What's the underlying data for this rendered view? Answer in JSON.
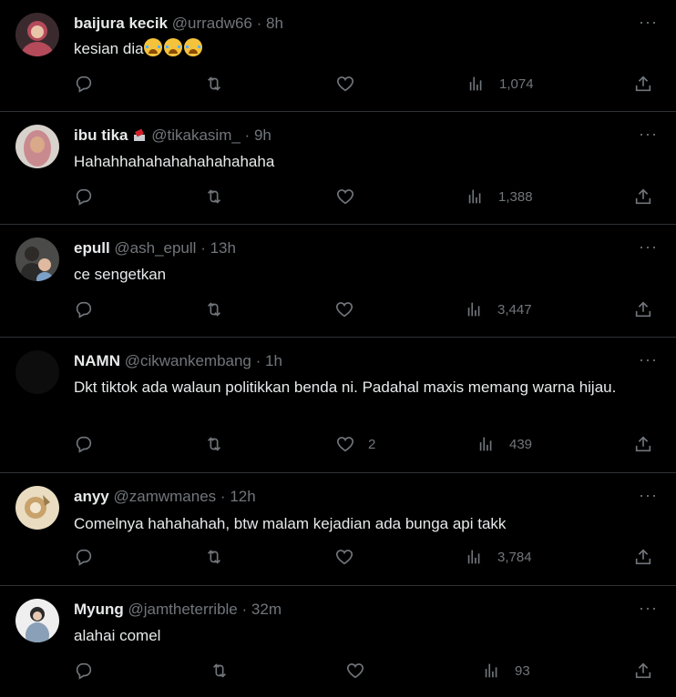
{
  "tweets": [
    {
      "name": "baijura kecik",
      "handle": "@urradw66",
      "time": "8h",
      "text": "kesian dia",
      "emoji_count": 3,
      "reply": "",
      "retweet": "",
      "like": "",
      "views": "1,074",
      "avatar_color": "#b44a5a"
    },
    {
      "name": "ibu tika",
      "handle": "@tikakasim_",
      "time": "9h",
      "text": "Hahahhahahahahahahahaha",
      "reply": "",
      "retweet": "",
      "like": "",
      "views": "1,388",
      "avatar_color": "#c98a8f"
    },
    {
      "name": "epull",
      "handle": "@ash_epull",
      "time": "13h",
      "text": "ce sengetkan",
      "reply": "",
      "retweet": "",
      "like": "",
      "views": "3,447",
      "avatar_color": "#6a6255"
    },
    {
      "name": "NAMN",
      "handle": "@cikwankembang",
      "time": "1h",
      "text": "Dkt tiktok ada walaun politikkan benda ni. Padahal maxis memang warna hijau.",
      "reply": "",
      "retweet": "",
      "like": "2",
      "views": "439",
      "avatar_color": "#0d0d0d"
    },
    {
      "name": "anyy",
      "handle": "@zamwmanes",
      "time": "12h",
      "text": "Comelnya hahahahah, btw malam kejadian ada bunga api takk",
      "reply": "",
      "retweet": "",
      "like": "",
      "views": "3,784",
      "avatar_color": "#c9a26b"
    },
    {
      "name": "Myung",
      "handle": "@jamtheterrible",
      "time": "32m",
      "text": "alahai comel",
      "reply": "",
      "retweet": "",
      "like": "",
      "views": "93",
      "avatar_color": "#d0d0d0"
    }
  ],
  "separator": "·",
  "more_label": "···",
  "icons": {
    "reply": "reply-icon",
    "retweet": "retweet-icon",
    "like": "like-icon",
    "views": "views-icon",
    "share": "share-icon",
    "more": "more-icon"
  },
  "colors": {
    "background": "#000000",
    "text": "#e7e9ea",
    "muted": "#71767b",
    "border": "#2f3336"
  }
}
